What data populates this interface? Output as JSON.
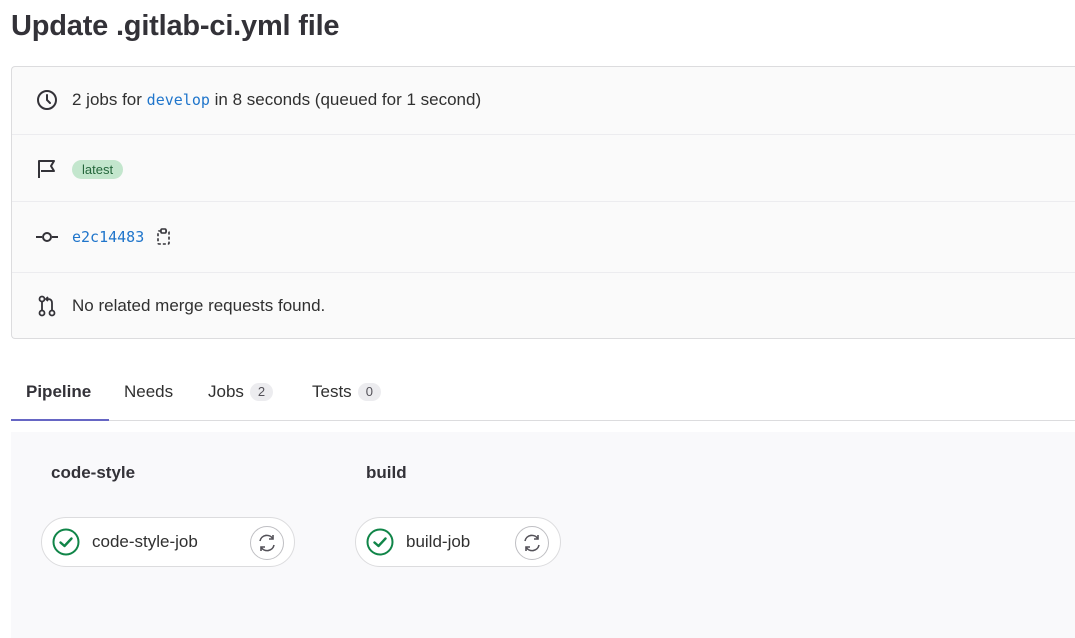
{
  "page": {
    "title": "Update .gitlab-ci.yml file"
  },
  "info": {
    "summary_prefix": "2 jobs for",
    "branch": "develop",
    "summary_suffix": "in 8 seconds (queued for 1 second)",
    "badge": "latest",
    "commit_sha": "e2c14483",
    "merge_requests": "No related merge requests found.",
    "icons": [
      "clock-icon",
      "flag-icon",
      "commit-icon",
      "copy-icon",
      "merge-request-icon"
    ]
  },
  "tabs": [
    {
      "label": "Pipeline",
      "active": true
    },
    {
      "label": "Needs"
    },
    {
      "label": "Jobs",
      "count": "2"
    },
    {
      "label": "Tests",
      "count": "0"
    }
  ],
  "stages": [
    {
      "name": "code-style",
      "job": "code-style-job",
      "status": "success"
    },
    {
      "name": "build",
      "job": "build-job",
      "status": "success"
    }
  ],
  "colors": {
    "success": "#108548",
    "link": "#1f75cb",
    "active_tab": "#6666c4",
    "badge_bg": "#c3e6cd"
  }
}
